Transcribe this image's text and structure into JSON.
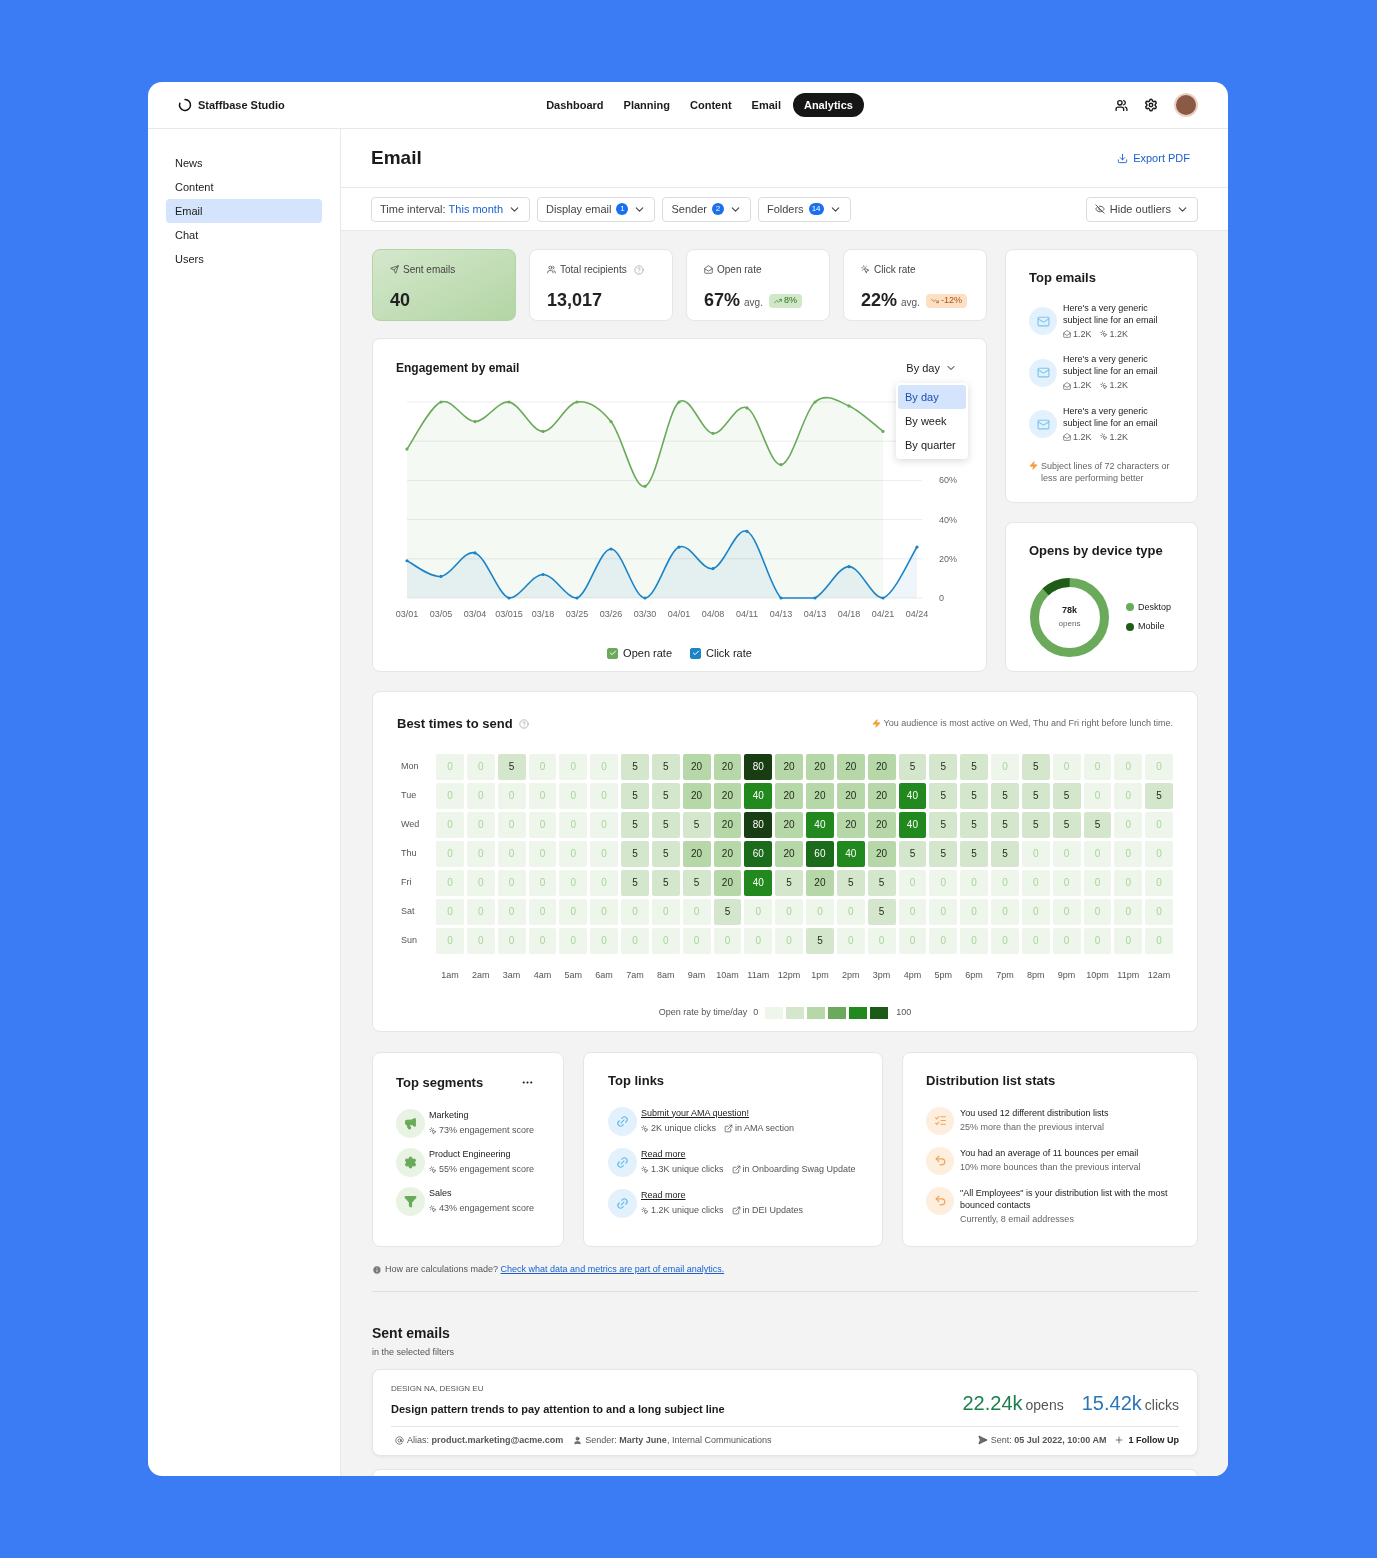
{
  "app": {
    "name": "Staffbase Studio"
  },
  "nav": [
    {
      "label": "Dashboard",
      "selected": false
    },
    {
      "label": "Planning",
      "selected": false
    },
    {
      "label": "Content",
      "selected": false
    },
    {
      "label": "Email",
      "selected": false
    },
    {
      "label": "Analytics",
      "selected": true
    }
  ],
  "sidebar": {
    "items": [
      {
        "label": "News",
        "selected": false
      },
      {
        "label": "Content",
        "selected": false
      },
      {
        "label": "Email",
        "selected": true
      },
      {
        "label": "Chat",
        "selected": false
      },
      {
        "label": "Users",
        "selected": false
      }
    ]
  },
  "page": {
    "title": "Email",
    "export": "Export PDF"
  },
  "filters": [
    {
      "label": "Time interval:",
      "value": "This month"
    },
    {
      "label": "Display email",
      "count": "1"
    },
    {
      "label": "Sender",
      "count": "2"
    },
    {
      "label": "Folders",
      "count": "14"
    }
  ],
  "hide_outliers": "Hide outliers",
  "kpis": [
    {
      "label": "Sent emails",
      "value": "40",
      "selected": true,
      "help": false
    },
    {
      "label": "Total recipients",
      "value": "13,017",
      "selected": false,
      "help": true
    },
    {
      "label": "Open rate",
      "value": "67%",
      "suffix": "avg.",
      "trend": {
        "text": "8%",
        "kind": "up"
      },
      "selected": false,
      "help": false
    },
    {
      "label": "Click rate",
      "value": "22%",
      "suffix": "avg.",
      "trend": {
        "text": "-12%",
        "kind": "down"
      },
      "selected": false,
      "help": false
    }
  ],
  "engagement": {
    "title": "Engagement by email",
    "select": "By day",
    "options": [
      {
        "label": "By day",
        "selected": true
      },
      {
        "label": "By week",
        "selected": false
      },
      {
        "label": "By quarter",
        "selected": false
      }
    ],
    "legend": [
      {
        "checked": true
      },
      {
        "checked": true
      }
    ],
    "chart_data": {
      "type": "line",
      "categories": [
        "03/01",
        "03/05",
        "03/04",
        "03/015",
        "03/18",
        "03/25",
        "03/26",
        "03/30",
        "04/01",
        "04/08",
        "04/11",
        "04/13",
        "04/13",
        "04/18",
        "04/21",
        "04/24"
      ],
      "series": [
        {
          "name": "Open rate",
          "color": "#6aaa5a",
          "values": [
            76,
            100,
            90,
            100,
            85,
            100,
            90,
            57,
            100,
            84,
            97,
            68,
            100,
            98,
            85,
            null
          ]
        },
        {
          "name": "Click rate",
          "color": "#1a84c7",
          "values": [
            19,
            11,
            23,
            0,
            12,
            0,
            25,
            0,
            26,
            15,
            34,
            0,
            0,
            16,
            0,
            26
          ]
        }
      ],
      "grid": true,
      "ylim": [
        0,
        100
      ],
      "yticks": [
        {
          "value": 0,
          "label": "0"
        },
        {
          "value": 20,
          "label": "20%"
        },
        {
          "value": 40,
          "label": "40%"
        },
        {
          "value": 60,
          "label": "60%"
        }
      ]
    }
  },
  "top_emails": {
    "title": "Top emails",
    "items": [
      {
        "subject": "Here's a very generic subject line for an email",
        "opens": "1.2K",
        "clicks": "1.2K"
      },
      {
        "subject": "Here's a very generic subject line for an email",
        "opens": "1.2K",
        "clicks": "1.2K"
      },
      {
        "subject": "Here's a very generic subject line for an email",
        "opens": "1.2K",
        "clicks": "1.2K"
      }
    ],
    "tip": "Subject lines of 72 characters or less are performing better"
  },
  "devices": {
    "title": "Opens by device type",
    "total": "78k",
    "total_label": "opens",
    "legend": [
      {
        "label": "Desktop",
        "color": "#6aaa5a"
      },
      {
        "label": "Mobile",
        "color": "#1e5c17"
      }
    ]
  },
  "best_times": {
    "title": "Best times to send",
    "tip": "You audience is most active on Wed, Thu and Fri right before lunch time.",
    "rows": [
      {
        "day": "Mon",
        "values": [
          "0",
          "0",
          "5",
          "0",
          "0",
          "0",
          "5",
          "5",
          "20",
          "20",
          "80",
          "20",
          "20",
          "20",
          "20",
          "5",
          "5",
          "5",
          "0",
          "5",
          "0",
          "0",
          "0",
          "0"
        ]
      },
      {
        "day": "Tue",
        "values": [
          "0",
          "0",
          "0",
          "0",
          "0",
          "0",
          "5",
          "5",
          "20",
          "20",
          "40",
          "20",
          "20",
          "20",
          "20",
          "40",
          "5",
          "5",
          "5",
          "5",
          "5",
          "0",
          "0",
          "5"
        ]
      },
      {
        "day": "Wed",
        "values": [
          "0",
          "0",
          "0",
          "0",
          "0",
          "0",
          "5",
          "5",
          "5",
          "20",
          "80",
          "20",
          "40",
          "20",
          "20",
          "40",
          "5",
          "5",
          "5",
          "5",
          "5",
          "5",
          "0",
          "0"
        ]
      },
      {
        "day": "Thu",
        "values": [
          "0",
          "0",
          "0",
          "0",
          "0",
          "0",
          "5",
          "5",
          "20",
          "20",
          "60",
          "20",
          "60",
          "40",
          "20",
          "5",
          "5",
          "5",
          "5",
          "0",
          "0",
          "0",
          "0",
          "0"
        ]
      },
      {
        "day": "Fri",
        "values": [
          "0",
          "0",
          "0",
          "0",
          "0",
          "0",
          "5",
          "5",
          "5",
          "20",
          "40",
          "5",
          "20",
          "5",
          "5",
          "0",
          "0",
          "0",
          "0",
          "0",
          "0",
          "0",
          "0",
          "0"
        ]
      },
      {
        "day": "Sat",
        "values": [
          "0",
          "0",
          "0",
          "0",
          "0",
          "0",
          "0",
          "0",
          "0",
          "5",
          "0",
          "0",
          "0",
          "0",
          "5",
          "0",
          "0",
          "0",
          "0",
          "0",
          "0",
          "0",
          "0",
          "0"
        ]
      },
      {
        "day": "Sun",
        "values": [
          "0",
          "0",
          "0",
          "0",
          "0",
          "0",
          "0",
          "0",
          "0",
          "0",
          "0",
          "0",
          "5",
          "0",
          "0",
          "0",
          "0",
          "0",
          "0",
          "0",
          "0",
          "0",
          "0",
          "0"
        ]
      }
    ],
    "hours": [
      "1am",
      "2am",
      "3am",
      "4am",
      "5am",
      "6am",
      "7am",
      "8am",
      "9am",
      "10am",
      "11am",
      "12pm",
      "1pm",
      "2pm",
      "3pm",
      "4pm",
      "5pm",
      "6pm",
      "7pm",
      "8pm",
      "9pm",
      "10pm",
      "11pm",
      "12am"
    ],
    "legend": {
      "label": "Open rate by time/day",
      "min": "0",
      "max": "100",
      "scale": [
        {
          "color": "#eef5ea"
        },
        {
          "color": "#d4e7cd"
        },
        {
          "color": "#b6d7a8"
        },
        {
          "color": "#6aaa5a"
        },
        {
          "color": "#22891e"
        },
        {
          "color": "#1c5a18"
        }
      ]
    }
  },
  "segments": {
    "title": "Top segments",
    "items": [
      {
        "name": "Marketing",
        "score": "73% engagement score"
      },
      {
        "name": "Product Engineering",
        "score": "55% engagement score"
      },
      {
        "name": "Sales",
        "score": "43% engagement score"
      }
    ]
  },
  "links": {
    "title": "Top links",
    "items": [
      {
        "label": "Submit your AMA question!",
        "clicks": "2K unique clicks",
        "location": "in AMA section"
      },
      {
        "label": "Read more",
        "clicks": "1.3K unique clicks",
        "location": "in Onboarding Swag Update"
      },
      {
        "label": "Read more",
        "clicks": "1.2K unique clicks",
        "location": "in DEI Updates"
      }
    ]
  },
  "distribution": {
    "title": "Distribution list stats",
    "items": [
      {
        "title": "You used 12 different distribution lists",
        "detail": "25% more than the previous interval"
      },
      {
        "title": "You had an average of 11 bounces per email",
        "detail": "10% more bounces than the previous interval"
      },
      {
        "title": "\"All Employees\" is your distribution list with the most bounced contacts",
        "detail": "Currently, 8 email addresses"
      }
    ]
  },
  "footnote": {
    "text": "How are calculations made?",
    "link": "Check what data and metrics are part of email analytics."
  },
  "sent_emails": {
    "title": "Sent emails",
    "subtitle": "in the selected filters",
    "items": [
      {
        "tags": "DESIGN NA, DESIGN EU",
        "subject": "Design pattern trends to pay attention to and a long subject line",
        "opens": "22.24k",
        "opens_label": "opens",
        "clicks": "15.42k",
        "clicks_label": "clicks",
        "alias": "Alias: **product.marketing@acme.com**",
        "sender": "Sender: **Marty June**, Internal Communications",
        "sent": "Sent: **05 Jul 2022, 10:00 AM**",
        "follow_up": "1 Follow Up"
      }
    ]
  }
}
